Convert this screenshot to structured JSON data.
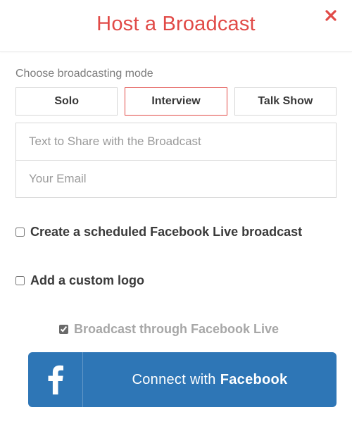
{
  "header": {
    "title": "Host a Broadcast"
  },
  "mode": {
    "label": "Choose broadcasting mode",
    "options": {
      "solo": "Solo",
      "interview": "Interview",
      "talkshow": "Talk Show"
    },
    "selected": "interview"
  },
  "inputs": {
    "share_placeholder": "Text to Share with the Broadcast",
    "share_value": "",
    "email_placeholder": "Your Email",
    "email_value": ""
  },
  "checks": {
    "scheduled_label": "Create a scheduled Facebook Live broadcast",
    "scheduled_checked": false,
    "logo_label": "Add a custom logo",
    "logo_checked": false,
    "through_label": "Broadcast through Facebook Live",
    "through_checked": true
  },
  "facebook": {
    "prefix": "Connect with",
    "brand": "Facebook"
  },
  "colors": {
    "accent": "#e14a47",
    "facebook": "#2e76b6"
  }
}
